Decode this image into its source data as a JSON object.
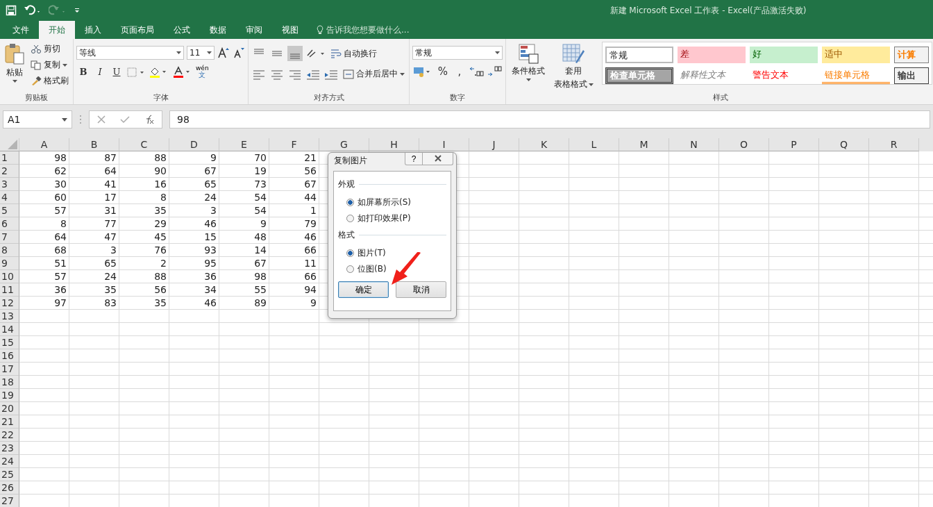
{
  "window": {
    "title": "新建 Microsoft Excel 工作表 - Excel(产品激活失败)"
  },
  "tabs": [
    {
      "label": "文件",
      "selected": false
    },
    {
      "label": "开始",
      "selected": true
    },
    {
      "label": "插入",
      "selected": false
    },
    {
      "label": "页面布局",
      "selected": false
    },
    {
      "label": "公式",
      "selected": false
    },
    {
      "label": "数据",
      "selected": false
    },
    {
      "label": "审阅",
      "selected": false
    },
    {
      "label": "视图",
      "selected": false
    }
  ],
  "tell_me": {
    "placeholder": "告诉我您想要做什么..."
  },
  "ribbon": {
    "clipboard": {
      "paste": "粘贴",
      "cut": "剪切",
      "copy": "复制",
      "format_painter": "格式刷",
      "label": "剪贴板"
    },
    "font": {
      "family": "等线",
      "size": "11",
      "label": "字体",
      "bold": "B",
      "italic": "I",
      "underline": "U",
      "phonetic": "wén",
      "phonetic_sub": "文"
    },
    "alignment": {
      "wrap": "自动换行",
      "merge": "合并后居中",
      "label": "对齐方式"
    },
    "number": {
      "format": "常规",
      "percent": "%",
      "comma": ",",
      "label": "数字"
    },
    "styles": {
      "conditional": "条件格式",
      "table_1": "套用",
      "table_2": "表格格式",
      "label": "样式",
      "cells": [
        {
          "label": "常规",
          "kind": "normal"
        },
        {
          "label": "差",
          "kind": "bad"
        },
        {
          "label": "好",
          "kind": "good"
        },
        {
          "label": "适中",
          "kind": "neutral"
        },
        {
          "label": "计算",
          "kind": "calc"
        },
        {
          "label": "检查单元格",
          "kind": "check"
        },
        {
          "label": "解释性文本",
          "kind": "explanatory"
        },
        {
          "label": "警告文本",
          "kind": "warning"
        },
        {
          "label": "链接单元格",
          "kind": "linked"
        },
        {
          "label": "输出",
          "kind": "output"
        }
      ]
    }
  },
  "formula_bar": {
    "name_box": "A1",
    "value": "98"
  },
  "grid": {
    "columns": [
      "A",
      "B",
      "C",
      "D",
      "E",
      "F",
      "G",
      "H",
      "I",
      "J",
      "K",
      "L",
      "M",
      "N",
      "O",
      "P",
      "Q",
      "R"
    ],
    "rows": [
      {
        "header": "1",
        "cells": [
          "98",
          "87",
          "88",
          "9",
          "70",
          "21"
        ]
      },
      {
        "header": "2",
        "cells": [
          "62",
          "64",
          "90",
          "67",
          "19",
          "56"
        ]
      },
      {
        "header": "3",
        "cells": [
          "30",
          "41",
          "16",
          "65",
          "73",
          "67"
        ]
      },
      {
        "header": "4",
        "cells": [
          "60",
          "17",
          "8",
          "24",
          "54",
          "44"
        ]
      },
      {
        "header": "5",
        "cells": [
          "57",
          "31",
          "35",
          "3",
          "54",
          "1"
        ]
      },
      {
        "header": "6",
        "cells": [
          "8",
          "77",
          "29",
          "46",
          "9",
          "79"
        ]
      },
      {
        "header": "7",
        "cells": [
          "64",
          "47",
          "45",
          "15",
          "48",
          "46"
        ]
      },
      {
        "header": "8",
        "cells": [
          "68",
          "3",
          "76",
          "93",
          "14",
          "66"
        ]
      },
      {
        "header": "9",
        "cells": [
          "51",
          "65",
          "2",
          "95",
          "67",
          "11"
        ]
      },
      {
        "header": "10",
        "cells": [
          "57",
          "24",
          "88",
          "36",
          "98",
          "66"
        ]
      },
      {
        "header": "11",
        "cells": [
          "36",
          "35",
          "56",
          "34",
          "55",
          "94"
        ]
      },
      {
        "header": "12",
        "cells": [
          "97",
          "83",
          "35",
          "46",
          "89",
          "9"
        ]
      },
      {
        "header": "13"
      },
      {
        "header": "14"
      },
      {
        "header": "15"
      },
      {
        "header": "16"
      },
      {
        "header": "17"
      },
      {
        "header": "18"
      },
      {
        "header": "19"
      },
      {
        "header": "20"
      },
      {
        "header": "21"
      },
      {
        "header": "22"
      },
      {
        "header": "23"
      },
      {
        "header": "24"
      },
      {
        "header": "25"
      },
      {
        "header": "26"
      },
      {
        "header": "27"
      }
    ]
  },
  "dialog": {
    "title": "复制图片",
    "help": "?",
    "groups": [
      {
        "title": "外观",
        "options": [
          {
            "label": "如屏幕所示(S)",
            "selected": true
          },
          {
            "label": "如打印效果(P)",
            "selected": false
          }
        ]
      },
      {
        "title": "格式",
        "options": [
          {
            "label": "图片(T)",
            "selected": true
          },
          {
            "label": "位图(B)",
            "selected": false
          }
        ]
      }
    ],
    "buttons": [
      {
        "label": "确定",
        "default": true
      },
      {
        "label": "取消",
        "default": false
      }
    ]
  }
}
